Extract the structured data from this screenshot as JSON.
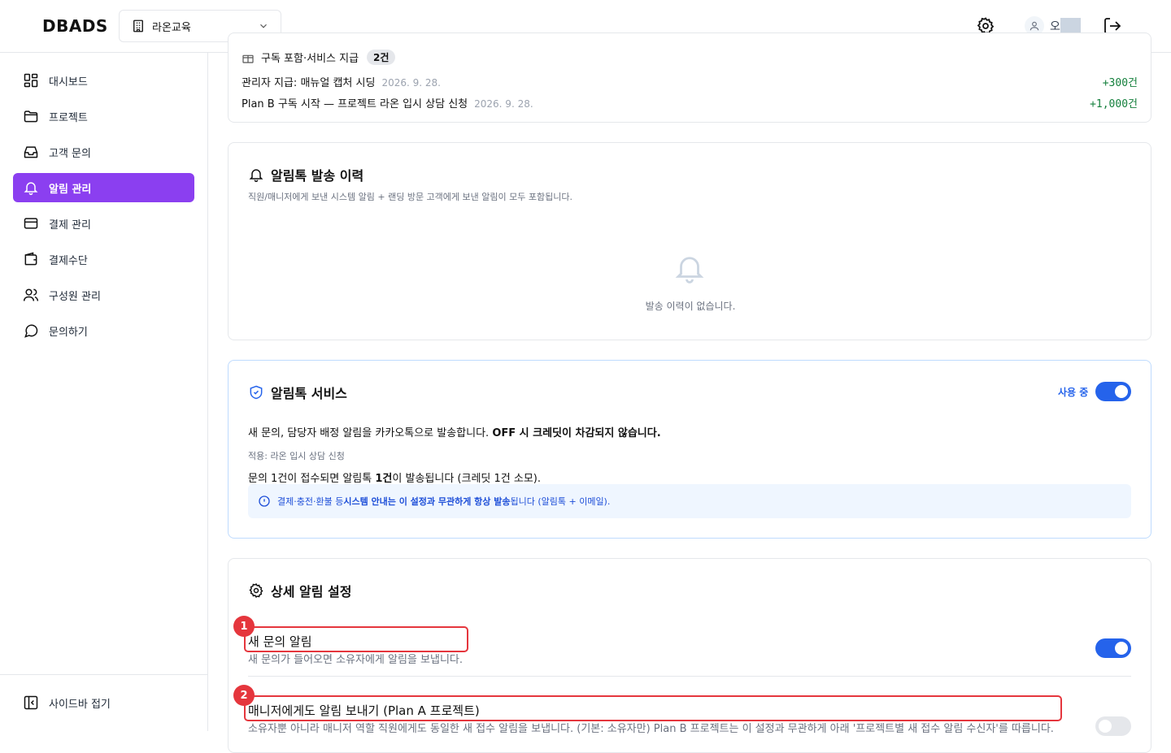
{
  "header": {
    "logo": "DBADS",
    "org_name": "라온교육",
    "user_initial": "오"
  },
  "sidebar": {
    "items": [
      {
        "label": "대시보드",
        "icon": "dashboard-icon"
      },
      {
        "label": "프로젝트",
        "icon": "folder-icon"
      },
      {
        "label": "고객 문의",
        "icon": "inbox-icon"
      },
      {
        "label": "알림 관리",
        "icon": "bell-icon",
        "active": true
      },
      {
        "label": "결제 관리",
        "icon": "credit-card-icon"
      },
      {
        "label": "결제수단",
        "icon": "wallet-icon"
      },
      {
        "label": "구성원 관리",
        "icon": "users-icon"
      },
      {
        "label": "문의하기",
        "icon": "chat-icon"
      }
    ],
    "collapse_label": "사이드바 접기"
  },
  "credits": {
    "partial_label": "구독 포함·서비스 지급",
    "partial_badge": "2건",
    "rows": [
      {
        "text": "관리자 지급: 매뉴얼 캡처 시딩",
        "date": "2026. 9. 28.",
        "amount": "+300건"
      },
      {
        "text": "Plan B 구독 시작 — 프로젝트 라온 입시 상담 신청",
        "date": "2026. 9. 28.",
        "amount": "+1,000건"
      }
    ]
  },
  "history": {
    "title": "알림톡 발송 이력",
    "subtitle": "직원/매니저에게 보낸 시스템 알림 + 랜딩 방문 고객에게 보낸 알림이 모두 포함됩니다.",
    "empty_text": "발송 이력이 없습니다."
  },
  "service": {
    "title": "알림톡 서비스",
    "status_label": "사용 중",
    "enabled": true,
    "desc_plain": "새 문의, 담당자 배정 알림을 카카오톡으로 발송합니다. ",
    "desc_bold": "OFF 시 크레딧이 차감되지 않습니다.",
    "applied": "적용: 라온 입시 상담 신청",
    "rule_pre": "문의 1건이 접수되면 알림톡 ",
    "rule_bold": "1건",
    "rule_post": "이 발송됩니다 (크레딧 1건 소모).",
    "info_pre": "결제·충전·환불 등 ",
    "info_bold": "시스템 안내는 이 설정과 무관하게 항상 발송",
    "info_post": "됩니다 (알림톡 + 이메일)."
  },
  "details": {
    "title": "상세 알림 설정",
    "settings": [
      {
        "title": "새 문의 알림",
        "desc": "새 문의가 들어오면 소유자에게 알림을 보냅니다.",
        "enabled": true,
        "marker": "1"
      },
      {
        "title": "매니저에게도 알림 보내기 (Plan A 프로젝트)",
        "desc": "소유자뿐 아니라 매니저 역할 직원에게도 동일한 새 접수 알림을 보냅니다. (기본: 소유자만) Plan B 프로젝트는 이 설정과 무관하게 아래 '프로젝트별 새 접수 알림 수신자'를 따릅니다.",
        "enabled": false,
        "marker": "2"
      }
    ]
  },
  "colors": {
    "accent": "#8b3ff0",
    "primary": "#2563eb",
    "positive": "#15803d",
    "highlight": "#e5363d"
  }
}
